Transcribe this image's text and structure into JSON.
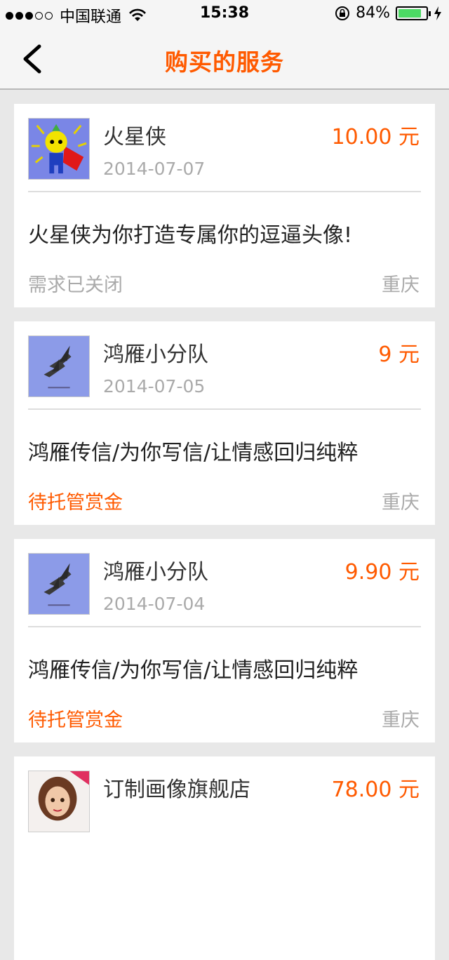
{
  "status_bar": {
    "carrier": "中国联通",
    "time": "15:38",
    "battery_text": "84%",
    "battery_level": 0.84,
    "signal_bars_on": 3,
    "signal_bars_total": 5,
    "battery_color": "#4cd964"
  },
  "nav": {
    "title": "购买的服务",
    "back_icon": "chevron-left-icon",
    "title_color": "#ff5a00"
  },
  "orders": [
    {
      "seller": "火星侠",
      "date": "2014-07-07",
      "price": "10.00 元",
      "description": "火星侠为你打造专属你的逗逼头像!",
      "status": "需求已关闭",
      "status_type": "closed",
      "city": "重庆",
      "avatar": "cartoon-hero-avatar"
    },
    {
      "seller": "鸿雁小分队",
      "date": "2014-07-05",
      "price": "9 元",
      "description": "鸿雁传信/为你写信/让情感回归纯粹",
      "status": "待托管赏金",
      "status_type": "pending",
      "city": "重庆",
      "avatar": "geese-avatar"
    },
    {
      "seller": "鸿雁小分队",
      "date": "2014-07-04",
      "price": "9.90 元",
      "description": "鸿雁传信/为你写信/让情感回归纯粹",
      "status": "待托管赏金",
      "status_type": "pending",
      "city": "重庆",
      "avatar": "geese-avatar"
    },
    {
      "seller": "订制画像旗舰店",
      "price": "78.00 元",
      "avatar": "portrait-avatar"
    }
  ]
}
